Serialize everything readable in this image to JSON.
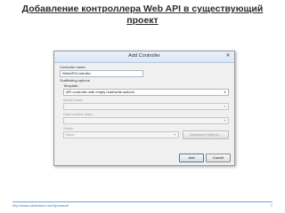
{
  "slide": {
    "title": "Добавление контроллера Web API в существующий проект",
    "footer_link": "http://www.slideshare.net/Sperasoft",
    "page_number": "7"
  },
  "dialog": {
    "title": "Add Controller",
    "close_glyph": "✕",
    "controller_name_label": "Controller name:",
    "controller_name_value": "WebAPIController",
    "scaffolding_label": "Scaffolding options",
    "template_label": "Template:",
    "template_value": "API controller with empty read/write actions",
    "model_class_label": "Model class:",
    "model_class_value": "",
    "data_context_label": "Data context class:",
    "data_context_value": "",
    "views_label": "Views:",
    "views_value": "None",
    "advanced_label": "Advanced Options...",
    "add_label": "Add",
    "cancel_label": "Cancel",
    "dropdown_glyph": "▾"
  }
}
